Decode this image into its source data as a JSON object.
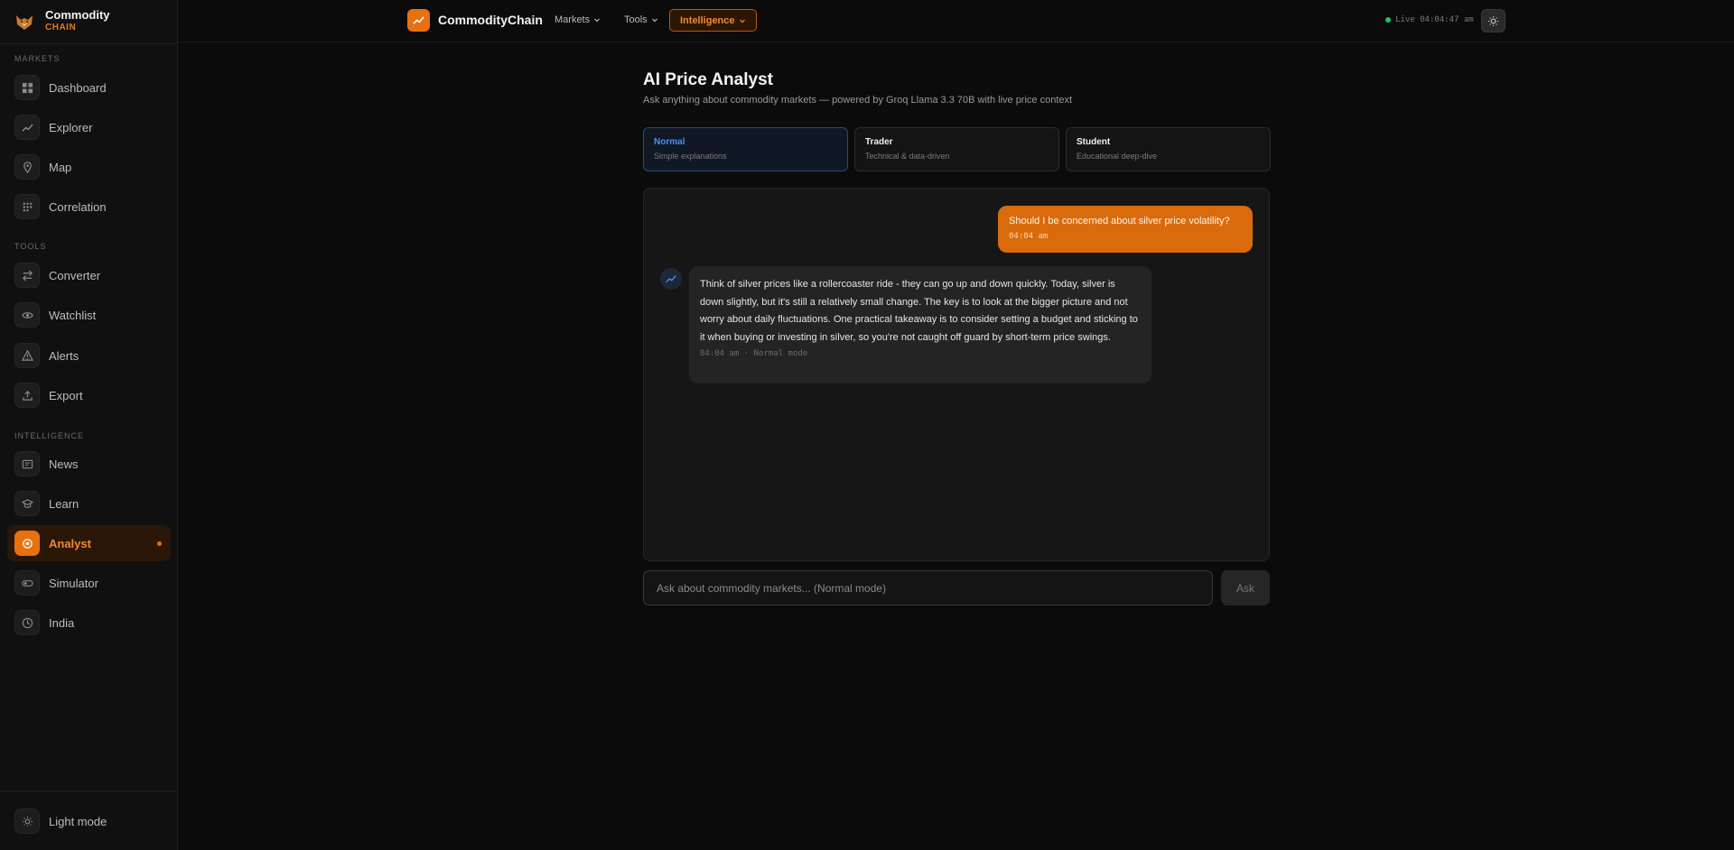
{
  "brand": {
    "name": "Commodity",
    "sub": "CHAIN"
  },
  "sidebar": {
    "sections": [
      {
        "label": "MARKETS"
      },
      {
        "label": "TOOLS"
      },
      {
        "label": "INTELLIGENCE"
      }
    ],
    "items": [
      {
        "label": "Dashboard",
        "icon": "grid-icon"
      },
      {
        "label": "Explorer",
        "icon": "trend-icon"
      },
      {
        "label": "Map",
        "icon": "pin-icon"
      },
      {
        "label": "Correlation",
        "icon": "dots-grid-icon"
      },
      {
        "label": "Converter",
        "icon": "swap-icon"
      },
      {
        "label": "Watchlist",
        "icon": "eye-icon"
      },
      {
        "label": "Alerts",
        "icon": "warning-icon"
      },
      {
        "label": "Export",
        "icon": "upload-icon"
      },
      {
        "label": "News",
        "icon": "newspaper-icon"
      },
      {
        "label": "Learn",
        "icon": "graduation-cap-icon"
      },
      {
        "label": "Analyst",
        "icon": "target-icon",
        "active": true
      },
      {
        "label": "Simulator",
        "icon": "toggle-icon"
      },
      {
        "label": "India",
        "icon": "clock-icon"
      }
    ],
    "footer_label": "Light mode"
  },
  "topbar": {
    "title": "CommodityChain",
    "menus": [
      "Markets",
      "Tools",
      "Intelligence"
    ],
    "live_text": "Live 04:04:47 am"
  },
  "main": {
    "title": "AI Price Analyst",
    "subtitle": "Ask anything about commodity markets — powered by Groq Llama 3.3 70B with live price context",
    "modes": [
      {
        "title": "Normal",
        "sub": "Simple explanations",
        "selected": true
      },
      {
        "title": "Trader",
        "sub": "Technical & data-driven"
      },
      {
        "title": "Student",
        "sub": "Educational deep-dive"
      }
    ],
    "chat": {
      "user_message": "Should I be concerned about silver price volatility?",
      "user_time": "04:04 am",
      "bot_message": "Think of silver prices like a rollercoaster ride - they can go up and down quickly. Today, silver is down slightly, but it's still a relatively small change. The key is to look at the bigger picture and not worry about daily fluctuations. One practical takeaway is to consider setting a budget and sticking to it when buying or investing in silver, so you're not caught off guard by short-term price swings.",
      "bot_meta": "04:04 am · Normal mode"
    },
    "input_placeholder": "Ask about commodity markets... (Normal mode)",
    "ask_label": "Ask"
  },
  "colors": {
    "accent": "#e8710f",
    "mode_selected": "#4f8ef0",
    "live": "#22c55e"
  }
}
